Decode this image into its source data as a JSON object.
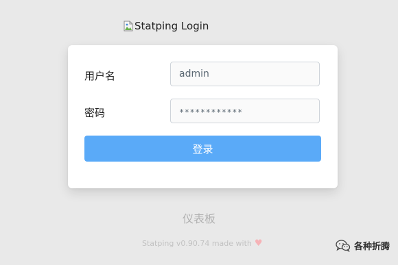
{
  "logo": {
    "alt_text": "Statping Login",
    "icon": "broken-image-icon"
  },
  "form": {
    "username_label": "用户名",
    "username_value": "admin",
    "password_label": "密码",
    "password_value": "************",
    "login_button_label": "登录"
  },
  "dashboard_link": "仪表板",
  "footer": {
    "text": "Statping v0.90.74 made with",
    "heart_icon": "♥"
  },
  "watermark": {
    "text": "各种折腾",
    "icon": "wechat-icon"
  },
  "colors": {
    "background": "#e9e9e9",
    "button": "#5aaaf8",
    "heart": "#f6b3b7"
  }
}
